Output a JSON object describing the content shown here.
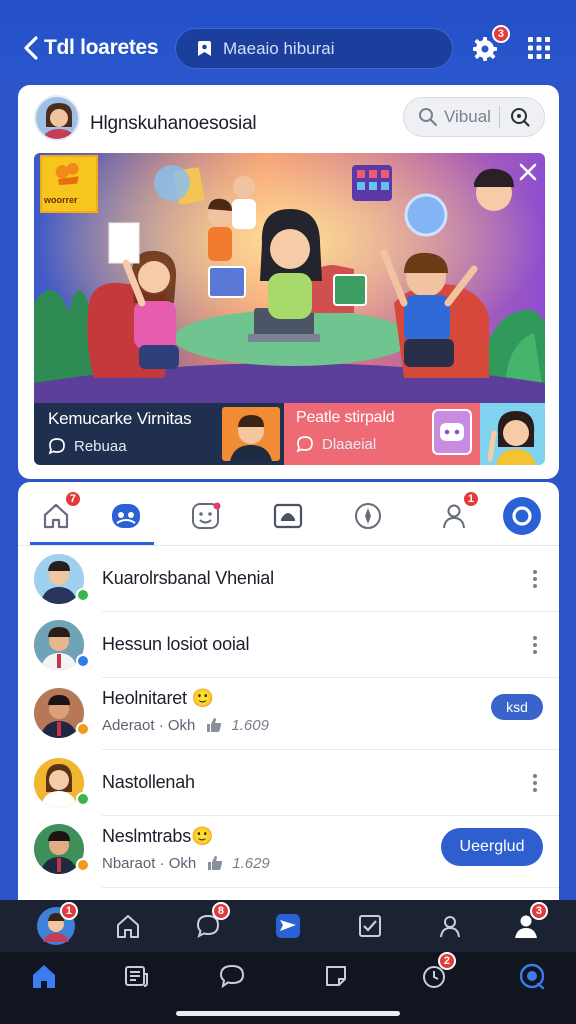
{
  "header": {
    "back_label": "Tdl loaretes",
    "search_placeholder": "Maeaio hiburai",
    "settings_badge": "3"
  },
  "feed_card": {
    "profile_name": "Hlgnskuhanoesosial",
    "mini_search_label": "Vibual",
    "banner": {
      "corner_logo_text": "woorrer",
      "left_title": "Kemucarke Virnitas",
      "left_sub": "Rebuaa",
      "mid_title": "Peatle stirpald",
      "mid_sub": "Dlaaeial"
    }
  },
  "tabs": [
    {
      "name": "home",
      "badge": "7"
    },
    {
      "name": "community",
      "badge": ""
    },
    {
      "name": "stickers",
      "badge": ""
    },
    {
      "name": "photos",
      "badge": ""
    },
    {
      "name": "explore",
      "badge": ""
    },
    {
      "name": "people",
      "badge": "1"
    },
    {
      "name": "target",
      "badge": ""
    }
  ],
  "contacts": [
    {
      "name": "Kuarolrsbanal Vhenial",
      "meta": "",
      "count": "",
      "action": "",
      "status_color": "#3bb54a"
    },
    {
      "name": "Hessun losiot ooial",
      "meta": "",
      "count": "",
      "action": "",
      "status_color": "#2f7be8"
    },
    {
      "name": "Heolnitaret 🙂",
      "meta": "Aderaot · Okh",
      "count": "1.609",
      "action": "ksd",
      "status_color": "#f39a1d"
    },
    {
      "name": "Nastollenah",
      "meta": "",
      "count": "",
      "action": "",
      "status_color": "#3bb54a"
    },
    {
      "name": "Neslmtrabs🙂",
      "meta": "Nbaraot · Okh",
      "count": "1.629",
      "action": "Ueerglud",
      "status_color": "#f39a1d"
    }
  ],
  "bottom_nav_top": {
    "avatar_badge": "1",
    "chat_badge": "8",
    "profile_badge": "3"
  },
  "bottom_nav_main": {
    "alerts_badge": "2"
  },
  "colors": {
    "brand_blue": "#2a57cc",
    "accent_blue": "#2f5fcf",
    "badge_red": "#e23b3b"
  }
}
